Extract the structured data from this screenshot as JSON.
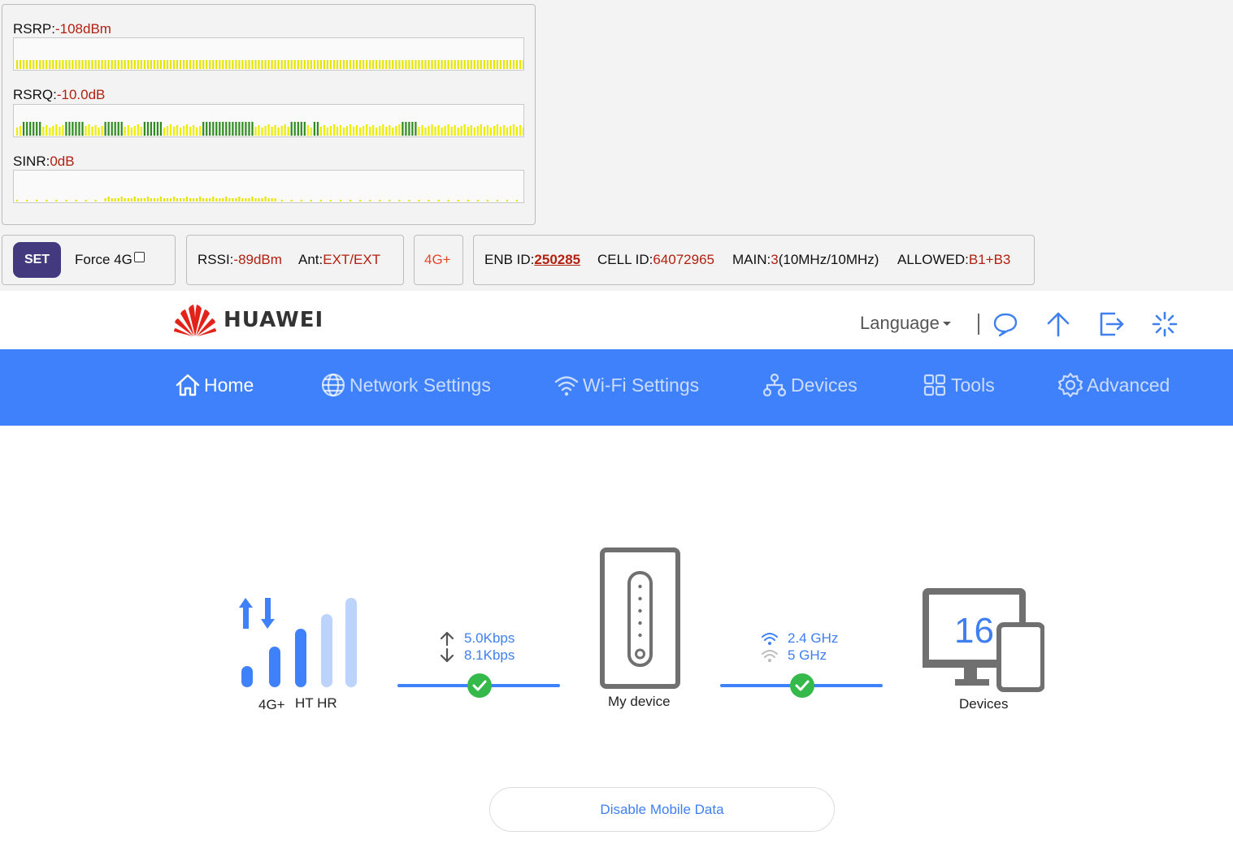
{
  "signal": {
    "rsrp": {
      "label": "RSRP:",
      "value": "-108dBm"
    },
    "rsrq": {
      "label": "RSRQ:",
      "value": "-10.0dB"
    },
    "sinr": {
      "label": "SINR:",
      "value": "0dB"
    }
  },
  "controls": {
    "set_label": "SET",
    "force4g_label": "Force 4G",
    "rssi_label": "RSSI:",
    "rssi_value": "-89dBm",
    "ant_label": "Ant:",
    "ant_value": "EXT/EXT",
    "network_type": "4G+",
    "enb_label": "ENB ID:",
    "enb_value": "250285",
    "cell_label": "CELL ID:",
    "cell_value": "64072965",
    "main_label": "MAIN:",
    "main_value": "3",
    "main_bw": "(10MHz/10MHz)",
    "allowed_label": "ALLOWED:",
    "allowed_value": "B1+B3"
  },
  "header": {
    "brand": "HUAWEI",
    "language_label": "Language",
    "icons": [
      "chat-icon",
      "upload-icon",
      "logout-icon",
      "loading-icon"
    ]
  },
  "nav": {
    "items": [
      {
        "label": "Home",
        "icon": "home-icon",
        "active": true
      },
      {
        "label": "Network Settings",
        "icon": "globe-icon"
      },
      {
        "label": "Wi-Fi Settings",
        "icon": "wifi-icon"
      },
      {
        "label": "Devices",
        "icon": "devices-tree-icon"
      },
      {
        "label": "Tools",
        "icon": "tools-grid-icon"
      },
      {
        "label": "Advanced",
        "icon": "gear-icon"
      }
    ]
  },
  "home": {
    "network_type": "4G+",
    "operator": "HT HR",
    "upload_speed": "5.0Kbps",
    "download_speed": "8.1Kbps",
    "device_label": "My device",
    "wifi_24": "2.4 GHz",
    "wifi_5": "5 GHz",
    "devices_count": "16",
    "devices_label": "Devices",
    "disable_button": "Disable Mobile Data"
  },
  "colors": {
    "accent": "#3f80fb",
    "brand_red": "#e2231a",
    "set_button": "#43397e",
    "value_red": "#b2200f",
    "ok_green": "#35b94b"
  }
}
